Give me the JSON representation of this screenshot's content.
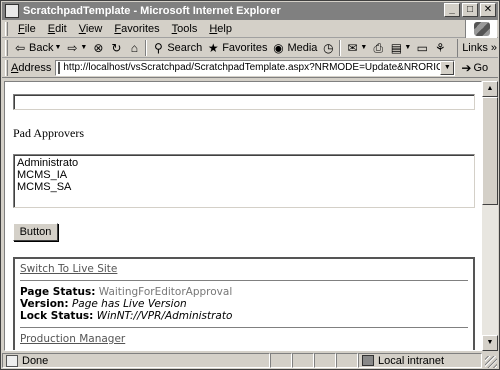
{
  "window": {
    "title": "ScratchpadTemplate - Microsoft Internet Explorer",
    "controls": {
      "minimize": "_",
      "maximize": "□",
      "close": "✕"
    }
  },
  "menu": {
    "items": [
      {
        "label": "File"
      },
      {
        "label": "Edit"
      },
      {
        "label": "View"
      },
      {
        "label": "Favorites"
      },
      {
        "label": "Tools"
      },
      {
        "label": "Help"
      }
    ]
  },
  "toolbar": {
    "back_label": "Back",
    "search_label": "Search",
    "favorites_label": "Favorites",
    "media_label": "Media",
    "links_label": "Links",
    "links_more": "»"
  },
  "address": {
    "label": "Address",
    "url": "http://localhost/vsScratchpad/ScratchpadTemplate.aspx?NRMODE=Update&NRORIGINALURL=%2fNR",
    "go_label": "Go"
  },
  "page": {
    "text_input_value": "",
    "approvers_label": "Pad Approvers",
    "approvers_options": [
      "Administrato",
      "MCMS_IA",
      "MCMS_SA"
    ],
    "button_label": "Button",
    "console": {
      "switch_link": "Switch To Live Site",
      "page_status_key": "Page Status:",
      "page_status_value": "WaitingForEditorApproval",
      "version_key": "Version:",
      "version_value": "Page has Live Version",
      "lock_key": "Lock Status:",
      "lock_value": "WinNT://VPR/Administrato",
      "production_link": "Production Manager"
    }
  },
  "status": {
    "text": "Done",
    "zone": "Local intranet"
  }
}
